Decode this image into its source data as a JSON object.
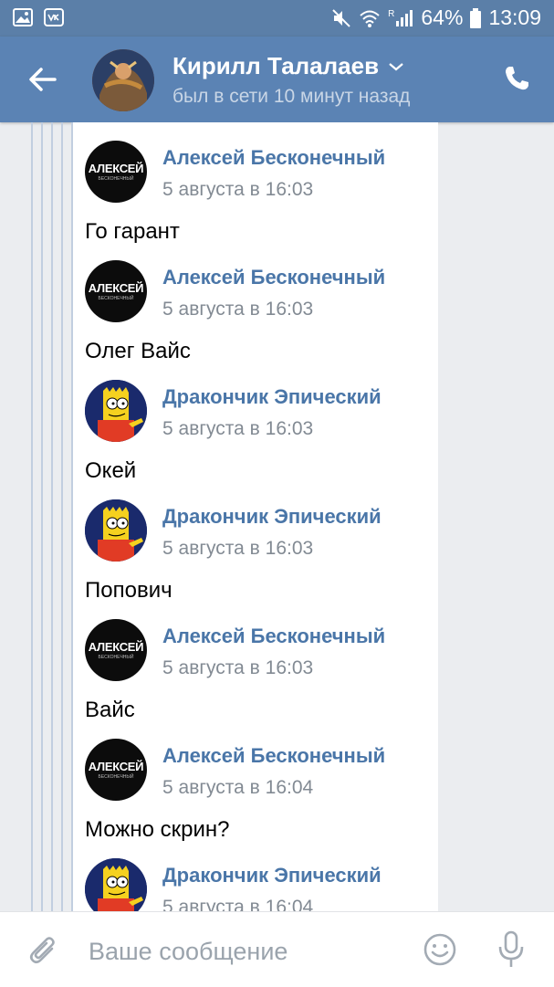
{
  "status_bar": {
    "battery": "64%",
    "time": "13:09",
    "network": "R"
  },
  "header": {
    "contact_name": "Кирилл Талалаев",
    "status": "был в сети 10 минут назад"
  },
  "avatars": {
    "aleksey_line1": "АЛЕКСЕЙ",
    "aleksey_line2": "БЕСКОНЕЧНЫЙ"
  },
  "messages": [
    {
      "author": "Алексей Бесконечный",
      "time": "5 августа в 16:03",
      "text": "Го гарант",
      "avatar": "aleksey-avatar"
    },
    {
      "author": "Алексей Бесконечный",
      "time": "5 августа в 16:03",
      "text": "Олег Вайс",
      "avatar": "aleksey-avatar"
    },
    {
      "author": "Дракончик Эпический",
      "time": "5 августа в 16:03",
      "text": "Окей",
      "avatar": "bart-avatar"
    },
    {
      "author": "Дракончик Эпический",
      "time": "5 августа в 16:03",
      "text": "Попович",
      "avatar": "bart-avatar"
    },
    {
      "author": "Алексей Бесконечный",
      "time": "5 августа в 16:03",
      "text": "Вайс",
      "avatar": "aleksey-avatar"
    },
    {
      "author": "Алексей Бесконечный",
      "time": "5 августа в 16:04",
      "text": "Можно скрин?",
      "avatar": "aleksey-avatar"
    },
    {
      "author": "Дракончик Эпический",
      "time": "5 августа в 16:04",
      "text": "",
      "avatar": "bart-avatar"
    }
  ],
  "composer": {
    "placeholder": "Ваше сообщение"
  },
  "colors": {
    "header": "#5b83b4",
    "status_bar": "#5b7fa8",
    "link": "#4a76a8"
  }
}
